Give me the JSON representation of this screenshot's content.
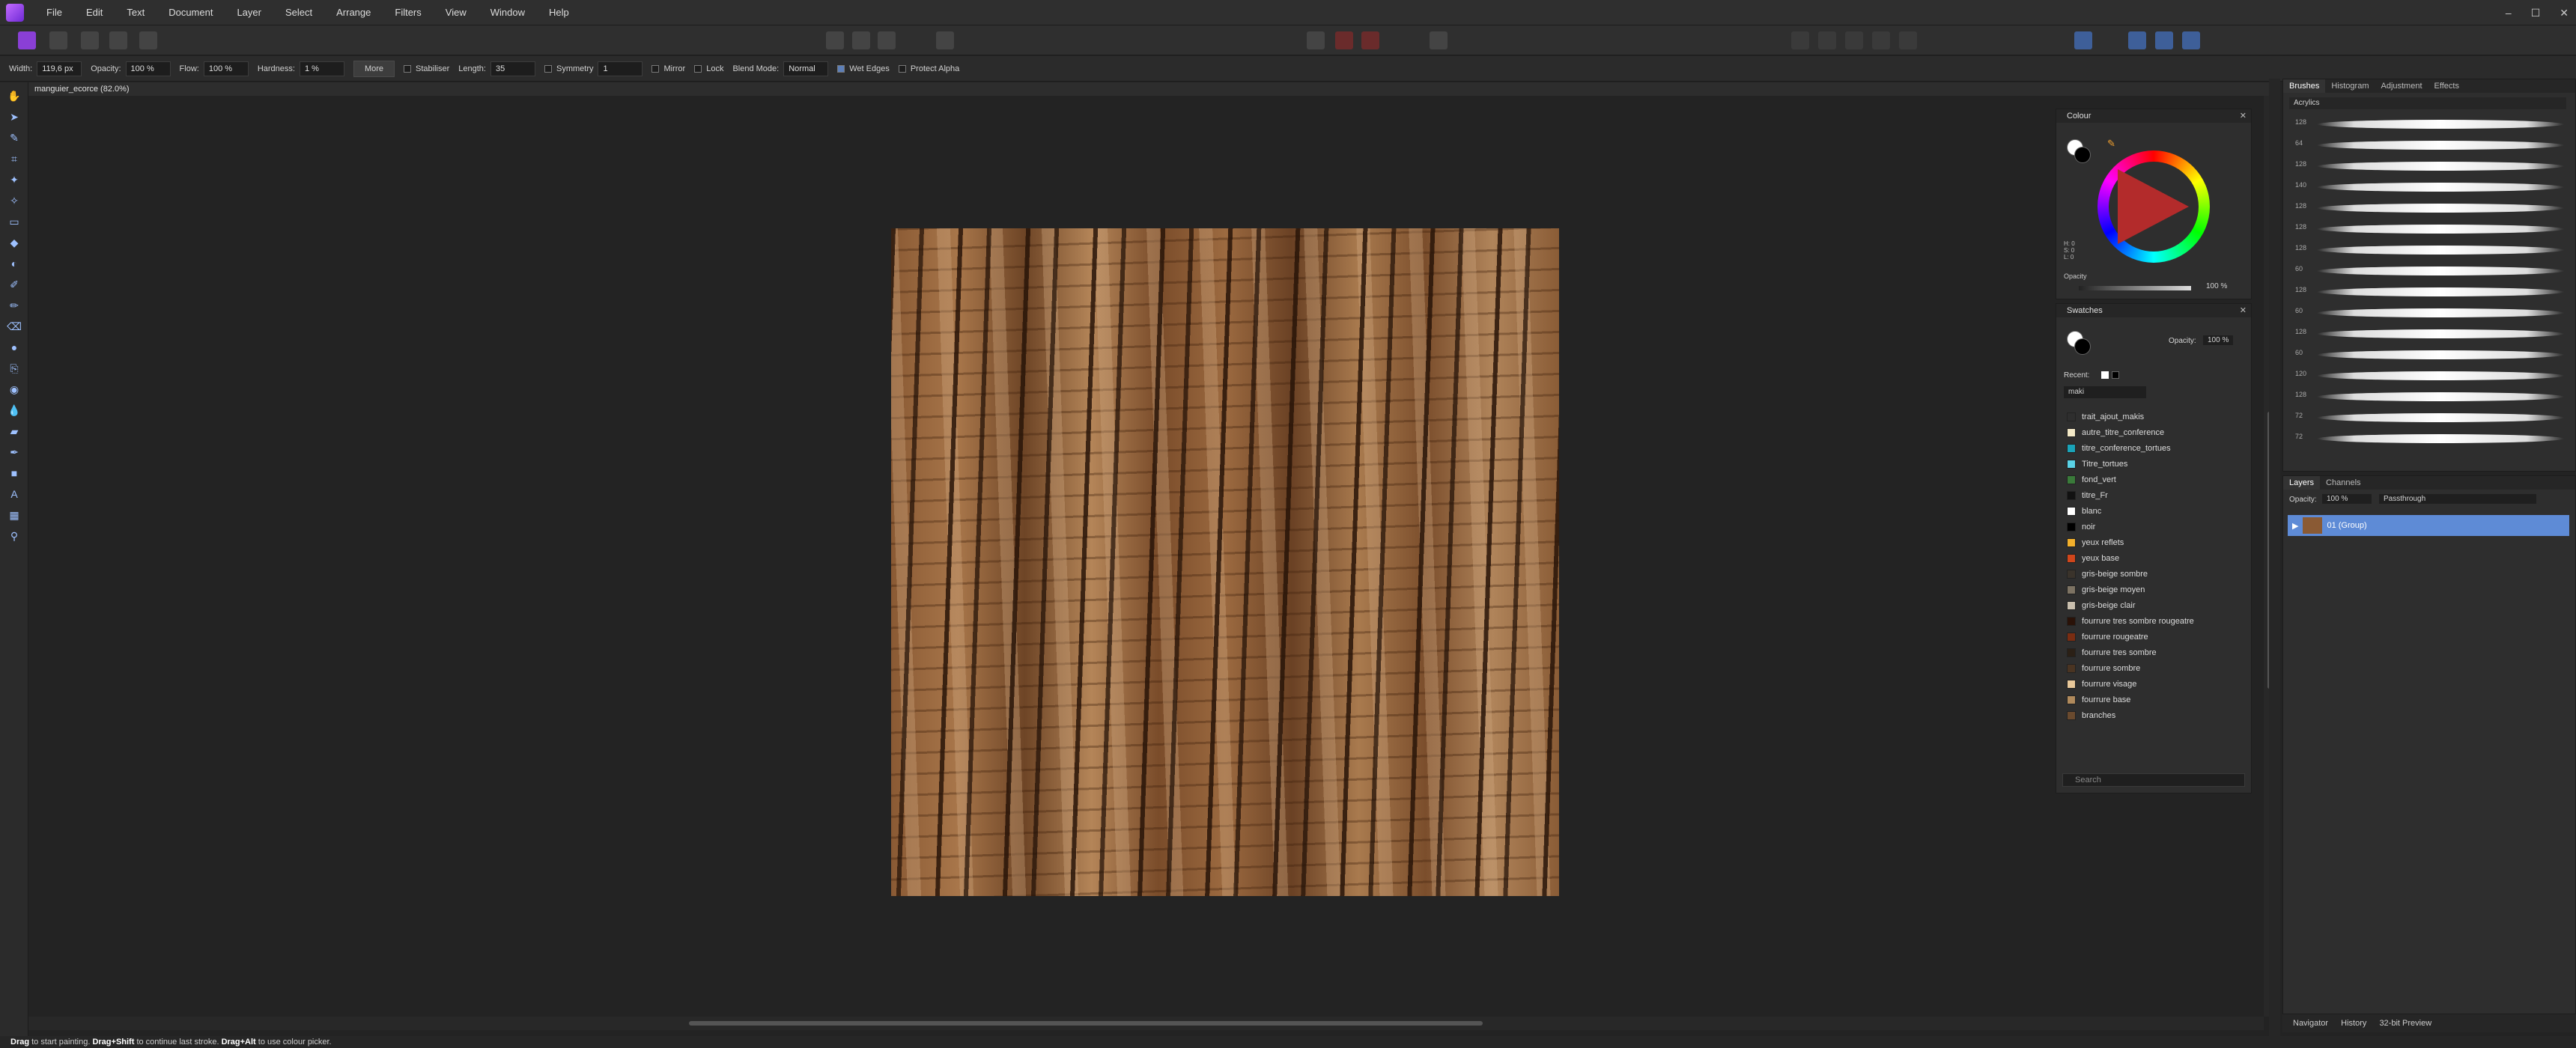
{
  "menu": [
    "File",
    "Edit",
    "Text",
    "Document",
    "Layer",
    "Select",
    "Arrange",
    "Filters",
    "View",
    "Window",
    "Help"
  ],
  "window_controls": [
    "–",
    "☐",
    "✕"
  ],
  "context": {
    "width_label": "Width:",
    "width_value": "119,6 px",
    "opacity_label": "Opacity:",
    "opacity_value": "100 %",
    "flow_label": "Flow:",
    "flow_value": "100 %",
    "hardness_label": "Hardness:",
    "hardness_value": "1 %",
    "more_label": "More",
    "stabiliser_label": "Stabiliser",
    "length_label": "Length:",
    "length_value": "35",
    "symmetry_label": "Symmetry",
    "symmetry_value": "1",
    "mirror_label": "Mirror",
    "lock_label": "Lock",
    "blend_label": "Blend Mode:",
    "blend_value": "Normal",
    "wet_label": "Wet Edges",
    "protect_label": "Protect Alpha"
  },
  "doc_tab": "manguier_ecorce (82.0%)",
  "colour": {
    "title": "Colour",
    "hsl": "H: 0\nS: 0\nL: 0",
    "opacity_label": "Opacity",
    "opacity_value": "100 %"
  },
  "swatches": {
    "title": "Swatches",
    "opacity_label": "Opacity:",
    "opacity_value": "100 %",
    "recent_label": "Recent:",
    "palette_name": "maki",
    "items": [
      {
        "name": "trait_ajout_makis",
        "color": "#2e2e2e"
      },
      {
        "name": "autre_titre_conference",
        "color": "#f2e8c6"
      },
      {
        "name": "titre_conference_tortues",
        "color": "#1aa3b8"
      },
      {
        "name": "Titre_tortues",
        "color": "#5ad2e6"
      },
      {
        "name": "fond_vert",
        "color": "#3a7a3a"
      },
      {
        "name": "titre_Fr",
        "color": "#111111"
      },
      {
        "name": "blanc",
        "color": "#ffffff"
      },
      {
        "name": "noir",
        "color": "#000000"
      },
      {
        "name": "yeux reflets",
        "color": "#f3b02c"
      },
      {
        "name": "yeux base",
        "color": "#d0461b"
      },
      {
        "name": "gris-beige sombre",
        "color": "#3a332b"
      },
      {
        "name": "gris-beige moyen",
        "color": "#7d7363"
      },
      {
        "name": "gris-beige clair",
        "color": "#c9bfae"
      },
      {
        "name": "fourrure tres sombre rougeatre",
        "color": "#2a1208"
      },
      {
        "name": "fourrure rougeatre",
        "color": "#7a2d12"
      },
      {
        "name": "fourrure tres sombre",
        "color": "#2b2016"
      },
      {
        "name": "fourrure sombre",
        "color": "#4a3422"
      },
      {
        "name": "fourrure visage",
        "color": "#e8c89a"
      },
      {
        "name": "fourrure base",
        "color": "#b08a5c"
      },
      {
        "name": "branches",
        "color": "#6a4a2e"
      }
    ],
    "search_placeholder": "Search"
  },
  "brush_tabs": [
    "Brushes",
    "Histogram",
    "Adjustment",
    "Effects"
  ],
  "brush_category": "Acrylics",
  "brush_sizes": [
    "128",
    "64",
    "128",
    "140",
    "128",
    "128",
    "128",
    "60",
    "128",
    "60",
    "128",
    "60",
    "120",
    "128",
    "72",
    "72"
  ],
  "layers": {
    "tabs": [
      "Layers",
      "Channels"
    ],
    "opacity_label": "Opacity:",
    "opacity_value": "100 %",
    "blend_value": "Passthrough",
    "row_label": "01 (Group)"
  },
  "bottom_tabs": [
    "Navigator",
    "History",
    "32-bit Preview"
  ],
  "status": {
    "drag": "Drag",
    "t1": " to start painting. ",
    "drag_shift": "Drag+Shift",
    "t2": " to continue last stroke. ",
    "drag_alt": "Drag+Alt",
    "t3": " to use colour picker."
  }
}
